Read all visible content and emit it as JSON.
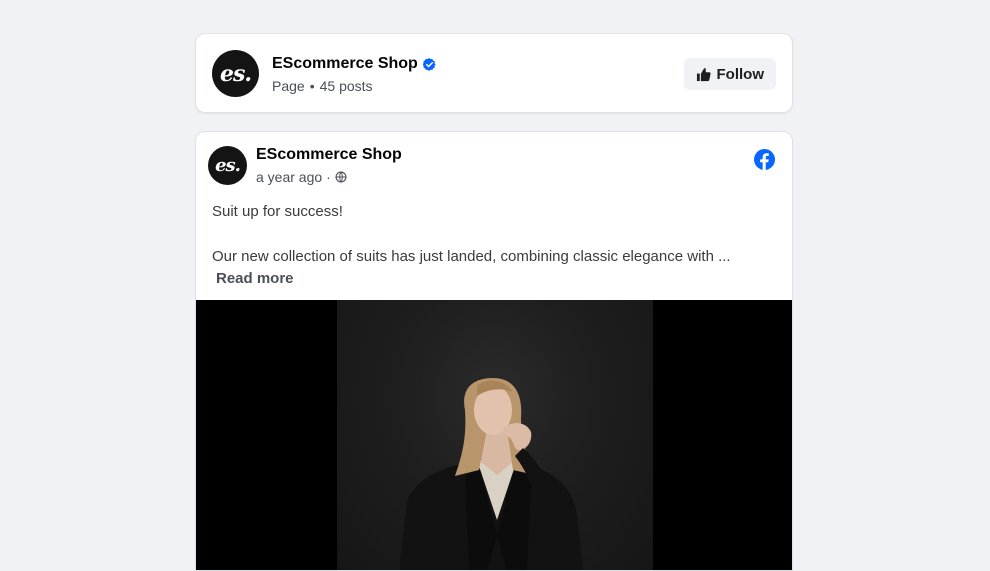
{
  "page_header": {
    "avatar_text": "es.",
    "name": "EScommerce Shop",
    "category": "Page",
    "separator": "•",
    "post_count": "45 posts",
    "follow_label": "Follow"
  },
  "post": {
    "avatar_text": "es.",
    "author": "EScommerce Shop",
    "time": "a year ago",
    "time_separator": "·",
    "line1": "Suit up for success!",
    "line2": "Our new collection of suits has just landed, combining classic elegance with ...",
    "read_more": "Read more"
  },
  "colors": {
    "verified_blue": "#0866ff",
    "facebook_blue": "#0866ff",
    "background": "#f0f2f5"
  },
  "icons": {
    "verified": "verified-badge-icon",
    "follow": "thumbs-up-icon",
    "audience": "globe-icon",
    "platform": "facebook-icon"
  }
}
